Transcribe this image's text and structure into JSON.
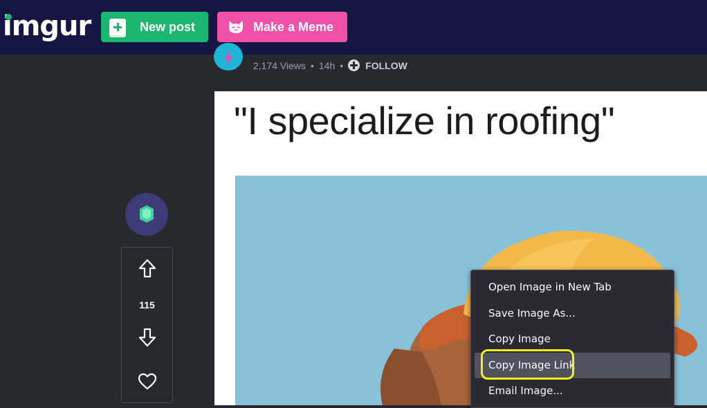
{
  "header": {
    "logo_text": "imgur",
    "new_post_label": "New post",
    "make_meme_label": "Make a Meme"
  },
  "post": {
    "views": "2,174 Views",
    "separator": "•",
    "age": "14h",
    "follow_label": "FOLLOW",
    "caption": "\"I specialize in roofing\""
  },
  "votes": {
    "count": "115"
  },
  "context_menu": {
    "items": [
      {
        "label": "Open Image in New Tab"
      },
      {
        "label": "Save Image As..."
      },
      {
        "label": "Copy Image"
      },
      {
        "label": "Copy Image Link",
        "hovered": true
      },
      {
        "label": "Email Image..."
      }
    ]
  },
  "colors": {
    "header_bg": "#171544",
    "page_bg": "#27292d",
    "new_post_green": "#1bb76e",
    "meme_pink": "#f050a8",
    "menu_bg": "#2b2a33",
    "highlight_yellow": "#f2f21a"
  },
  "icons": {
    "new_post": "plus-square-icon",
    "meme": "cat-face-icon",
    "follow": "plus-circle-icon",
    "upvote": "arrow-up-icon",
    "downvote": "arrow-down-icon",
    "favorite": "heart-icon",
    "badge": "emerald-icon"
  }
}
